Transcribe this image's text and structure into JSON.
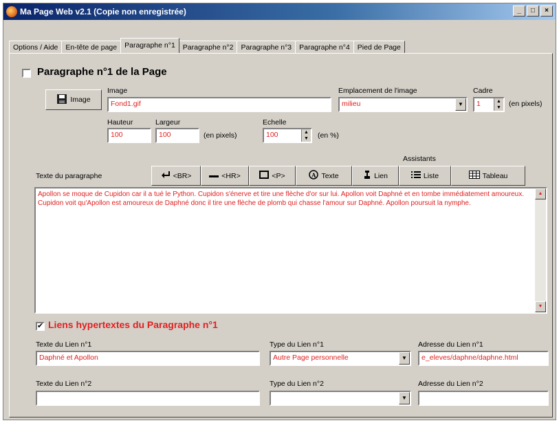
{
  "window": {
    "title": "Ma Page Web v2.1 (Copie non enregistrée)",
    "buttons": [
      "_",
      "□",
      "×"
    ]
  },
  "tabs": [
    {
      "label": "Options / Aide",
      "active": false
    },
    {
      "label": "En-tête de page",
      "active": false
    },
    {
      "label": "Paragraphe n°1",
      "active": true
    },
    {
      "label": "Paragraphe n°2",
      "active": false
    },
    {
      "label": "Paragraphe n°3",
      "active": false
    },
    {
      "label": "Paragraphe n°4",
      "active": false
    },
    {
      "label": "Pied de Page",
      "active": false
    }
  ],
  "section1": {
    "title": "Paragraphe n°1 de la Page",
    "checked": false
  },
  "image": {
    "button_label": "Image",
    "label": "Image",
    "value": "Fond1.gif",
    "emplacement_label": "Emplacement de l'image",
    "emplacement_value": "milieu",
    "cadre_label": "Cadre",
    "cadre_value": "1",
    "cadre_unit": "(en pixels)",
    "hauteur_label": "Hauteur",
    "hauteur_value": "100",
    "largeur_label": "Largeur",
    "largeur_value": "100",
    "size_unit": "(en pixels)",
    "echelle_label": "Echelle",
    "echelle_value": "100",
    "echelle_unit": "(en %)"
  },
  "paragraph": {
    "label": "Texte du paragraphe",
    "assistants_label": "Assistants",
    "text": "Apollon se moque de Cupidon car il a tué le Python. Cupidon s'énerve et tire une flèche d'or sur lui. Apollon voit Daphné et en tombe immédiatement amoureux. Cupidon voit qu'Apollon est amoureux de Daphné donc il tire une flèche de plomb qui chasse l'amour sur Daphné. Apollon poursuit la nymphe."
  },
  "assistants": [
    {
      "icon": "enter-arrow-icon",
      "label": "<BR>"
    },
    {
      "icon": "horizontal-rule-icon",
      "label": "<HR>"
    },
    {
      "icon": "paragraph-box-icon",
      "label": "<P>"
    },
    {
      "icon": "text-style-icon",
      "label": "Texte"
    },
    {
      "icon": "link-icon",
      "label": "Lien"
    },
    {
      "icon": "list-icon",
      "label": "Liste"
    },
    {
      "icon": "table-icon",
      "label": "Tableau"
    }
  ],
  "links_section": {
    "title": "Liens hypertextes du Paragraphe n°1",
    "checked": true,
    "title_color": "#e02020"
  },
  "links": [
    {
      "text_label": "Texte du Lien n°1",
      "text_value": "Daphné et Apollon",
      "type_label": "Type du Lien n°1",
      "type_value": "Autre Page personnelle",
      "address_label": "Adresse du Lien n°1",
      "address_value": "e_eleves/daphne/daphne.html"
    },
    {
      "text_label": "Texte du Lien n°2",
      "text_value": "",
      "type_label": "Type du Lien n°2",
      "type_value": "",
      "address_label": "Adresse du Lien n°2",
      "address_value": ""
    }
  ],
  "colors": {
    "value_text": "#e02020",
    "face": "#d4d0c8",
    "titlebar": "#0a246a"
  }
}
